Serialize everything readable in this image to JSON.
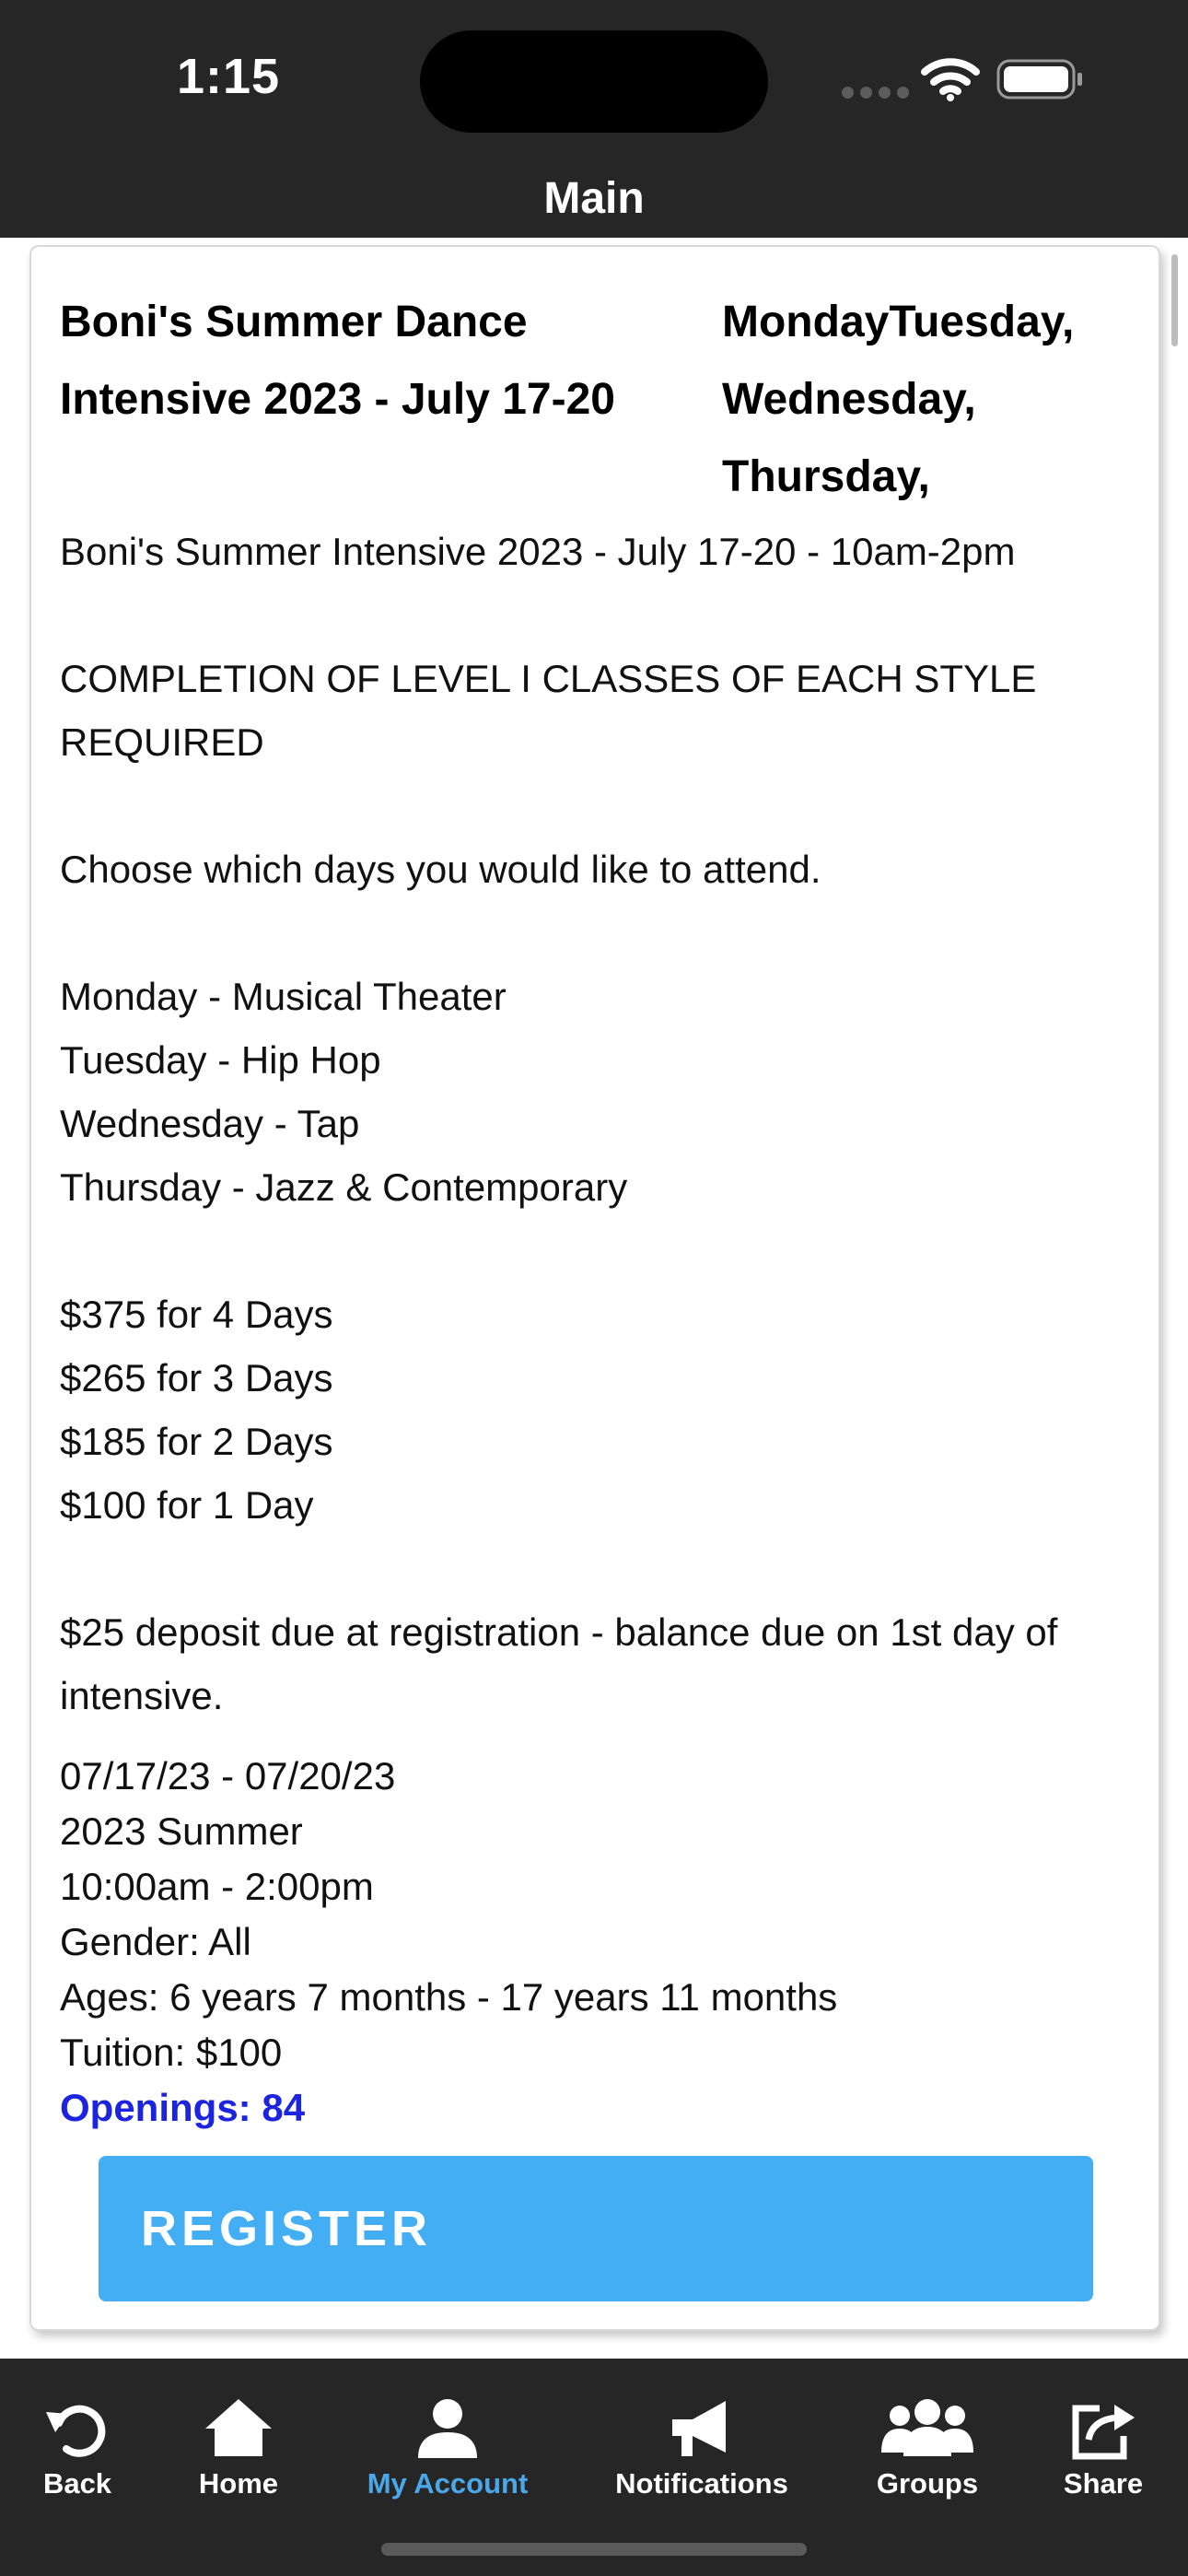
{
  "status_bar": {
    "time": "1:15"
  },
  "nav": {
    "title": "Main"
  },
  "class": {
    "name": "Boni's Summer Dance Intensive 2023 - July 17-20",
    "days_lines": [
      "MondayTuesday,",
      "Wednesday,",
      "Thursday,"
    ],
    "description": [
      "Boni's Summer Intensive 2023 - July 17-20 - 10am-2pm",
      "",
      "COMPLETION OF LEVEL I CLASSES OF EACH STYLE REQUIRED",
      "",
      "Choose which days you would like to attend.",
      "",
      "Monday - Musical Theater",
      "Tuesday - Hip Hop",
      "Wednesday - Tap",
      "Thursday - Jazz & Contemporary",
      "",
      "$375 for 4 Days",
      "$265 for 3 Days",
      "$185 for 2 Days",
      "$100 for 1 Day",
      "",
      "$25 deposit due at registration - balance due on 1st day of intensive."
    ],
    "dates": "07/17/23 - 07/20/23",
    "session": "2023 Summer",
    "time": "10:00am - 2:00pm",
    "gender": "Gender: All",
    "ages": "Ages: 6 years 7 months - 17 years 11 months",
    "tuition": "Tuition: $100",
    "openings": "Openings: 84",
    "register_label": "REGISTER"
  },
  "tabs": [
    {
      "label": "Back",
      "icon": "undo-arrow-icon",
      "active": false
    },
    {
      "label": "Home",
      "icon": "home-icon",
      "active": false
    },
    {
      "label": "My Account",
      "icon": "person-icon",
      "active": true
    },
    {
      "label": "Notifications",
      "icon": "megaphone-icon",
      "active": false
    },
    {
      "label": "Groups",
      "icon": "group-icon",
      "active": false
    },
    {
      "label": "Share",
      "icon": "share-icon",
      "active": false
    }
  ],
  "colors": {
    "bar_background": "#262626",
    "accent": "#43aef3",
    "active_tab": "#4aa7e8",
    "openings": "#1c24e0"
  }
}
